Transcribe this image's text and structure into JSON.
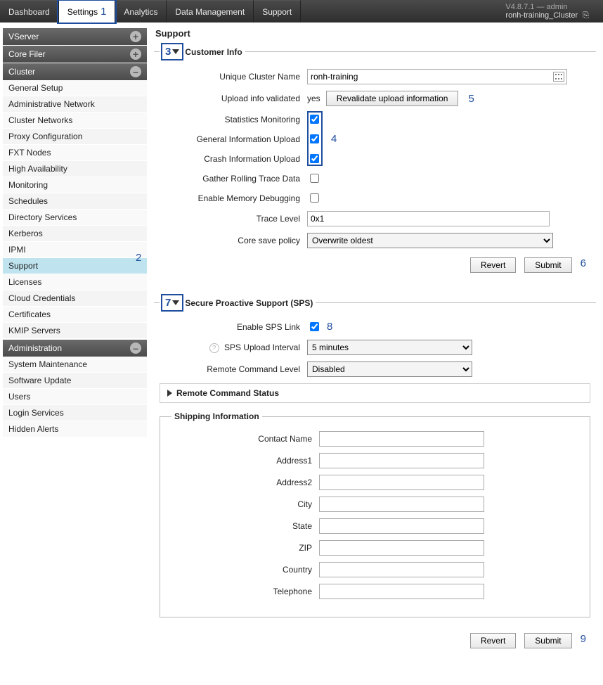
{
  "topbar": {
    "tabs": [
      "Dashboard",
      "Settings",
      "Analytics",
      "Data Management",
      "Support"
    ],
    "active_index": 1,
    "version_line": "V4.8.7.1 — admin",
    "cluster_line": "ronh-training_Cluster"
  },
  "callouts": {
    "n1": "1",
    "n2": "2",
    "n3": "3",
    "n4": "4",
    "n5": "5",
    "n6": "6",
    "n7": "7",
    "n8": "8",
    "n9": "9"
  },
  "sidebar": {
    "groups": [
      {
        "title": "VServer",
        "open": false,
        "icon": "plus",
        "items": []
      },
      {
        "title": "Core Filer",
        "open": false,
        "icon": "plus",
        "items": []
      },
      {
        "title": "Cluster",
        "open": true,
        "icon": "minus",
        "items": [
          "General Setup",
          "Administrative Network",
          "Cluster Networks",
          "Proxy Configuration",
          "FXT Nodes",
          "High Availability",
          "Monitoring",
          "Schedules",
          "Directory Services",
          "Kerberos",
          "IPMI",
          "Support",
          "Licenses",
          "Cloud Credentials",
          "Certificates",
          "KMIP Servers"
        ],
        "selected": "Support"
      },
      {
        "title": "Administration",
        "open": true,
        "icon": "minus",
        "items": [
          "System Maintenance",
          "Software Update",
          "Users",
          "Login Services",
          "Hidden Alerts"
        ]
      }
    ]
  },
  "page": {
    "title": "Support"
  },
  "customer": {
    "legend": "Customer Info",
    "cluster_name_label": "Unique Cluster Name",
    "cluster_name_value": "ronh-training",
    "upload_validated_label": "Upload info validated",
    "upload_validated_value": "yes",
    "revalidate_button": "Revalidate upload information",
    "stats_label": "Statistics Monitoring",
    "stats_checked": true,
    "gen_label": "General Information Upload",
    "gen_checked": true,
    "crash_label": "Crash Information Upload",
    "crash_checked": true,
    "rolling_label": "Gather Rolling Trace Data",
    "rolling_checked": false,
    "memdbg_label": "Enable Memory Debugging",
    "memdbg_checked": false,
    "trace_label": "Trace Level",
    "trace_value": "0x1",
    "core_policy_label": "Core save policy",
    "core_policy_value": "Overwrite oldest",
    "revert": "Revert",
    "submit": "Submit"
  },
  "sps": {
    "legend": "Secure Proactive Support (SPS)",
    "enable_label": "Enable SPS Link",
    "enable_checked": true,
    "interval_label": "SPS Upload Interval",
    "interval_value": "5 minutes",
    "rcl_label": "Remote Command Level",
    "rcl_value": "Disabled",
    "rc_status_label": "Remote Command Status",
    "ship_legend": "Shipping Information",
    "fields": {
      "contact": "Contact Name",
      "addr1": "Address1",
      "addr2": "Address2",
      "city": "City",
      "state": "State",
      "zip": "ZIP",
      "country": "Country",
      "phone": "Telephone"
    },
    "revert": "Revert",
    "submit": "Submit"
  }
}
